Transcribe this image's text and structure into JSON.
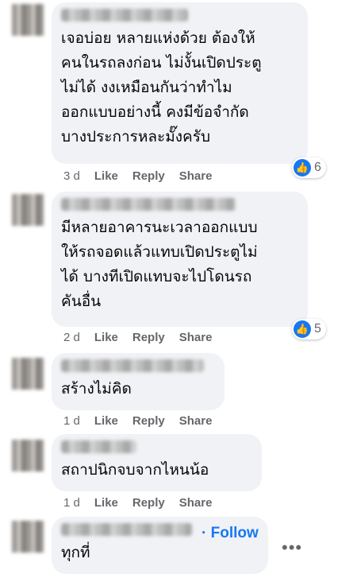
{
  "colors": {
    "accent": "#1877f2",
    "bubble": "#f0f2f5",
    "meta": "#65676b"
  },
  "comments": [
    {
      "author": "(blurred name)",
      "text": "เจอบ่อย หลายแห่งด้วย ต้องให้\nคนในรถลงก่อน ไม่งั้นเปิดประตู\nไม่ได้ งงเหมือนกันว่าทำไม\nออกแบบอย่างนี้ คงมีข้อจำกัด\nบางประการหละมั๊งครับ",
      "age": "3 d",
      "like": "Like",
      "reply": "Reply",
      "share": "Share",
      "reactions": "6",
      "reaction_icon": "thumbs-up-icon"
    },
    {
      "author": "(blurred name)",
      "text": "มีหลายอาคารนะเวลาออกแบบ\nให้รถจอดแล้วแทบเปิดประตูไม่\nได้ บางทีเปิดแทบจะไปโดนรถ\nคันอื่น",
      "age": "2 d",
      "like": "Like",
      "reply": "Reply",
      "share": "Share",
      "reactions": "5",
      "reaction_icon": "thumbs-up-icon"
    },
    {
      "author": "(blurred name)",
      "text": "สร้างไม่คิด",
      "age": "1 d",
      "like": "Like",
      "reply": "Reply",
      "share": "Share"
    },
    {
      "author": "(blurred name)",
      "text": "สถาปนิกจบจากไหนน้อ",
      "age": "1 d",
      "like": "Like",
      "reply": "Reply",
      "share": "Share"
    },
    {
      "author": "(blurred name)",
      "text": "ทุกที่",
      "follow": "· Follow",
      "more": "•••"
    }
  ]
}
